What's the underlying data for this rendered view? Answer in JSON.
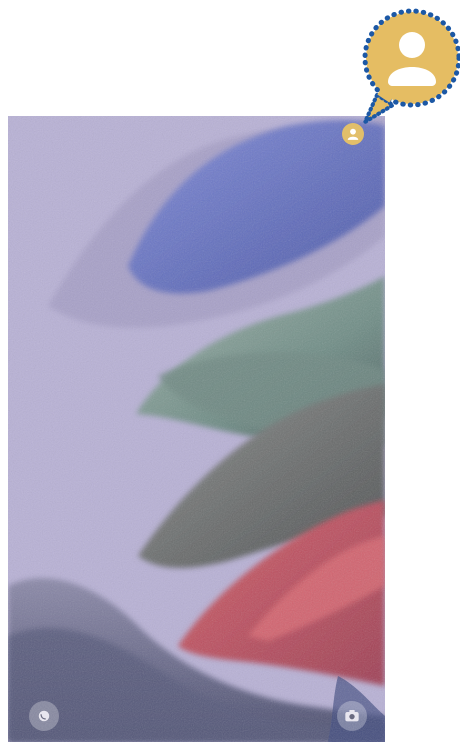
{
  "screen": {
    "kind": "lock-screen",
    "wallpaper_colors": {
      "sky": "#b7b0d4",
      "blue": "#5f6fc0",
      "green": "#7e9a93",
      "grey": "#6f7275",
      "pink": "#c1515f"
    }
  },
  "icons": {
    "profile": "user-profile-icon",
    "shortcut_left": "phone-shortcut-icon",
    "shortcut_right": "camera-shortcut-icon"
  },
  "callout": {
    "fill": "#e5bd63",
    "border": "#1c58a5"
  }
}
